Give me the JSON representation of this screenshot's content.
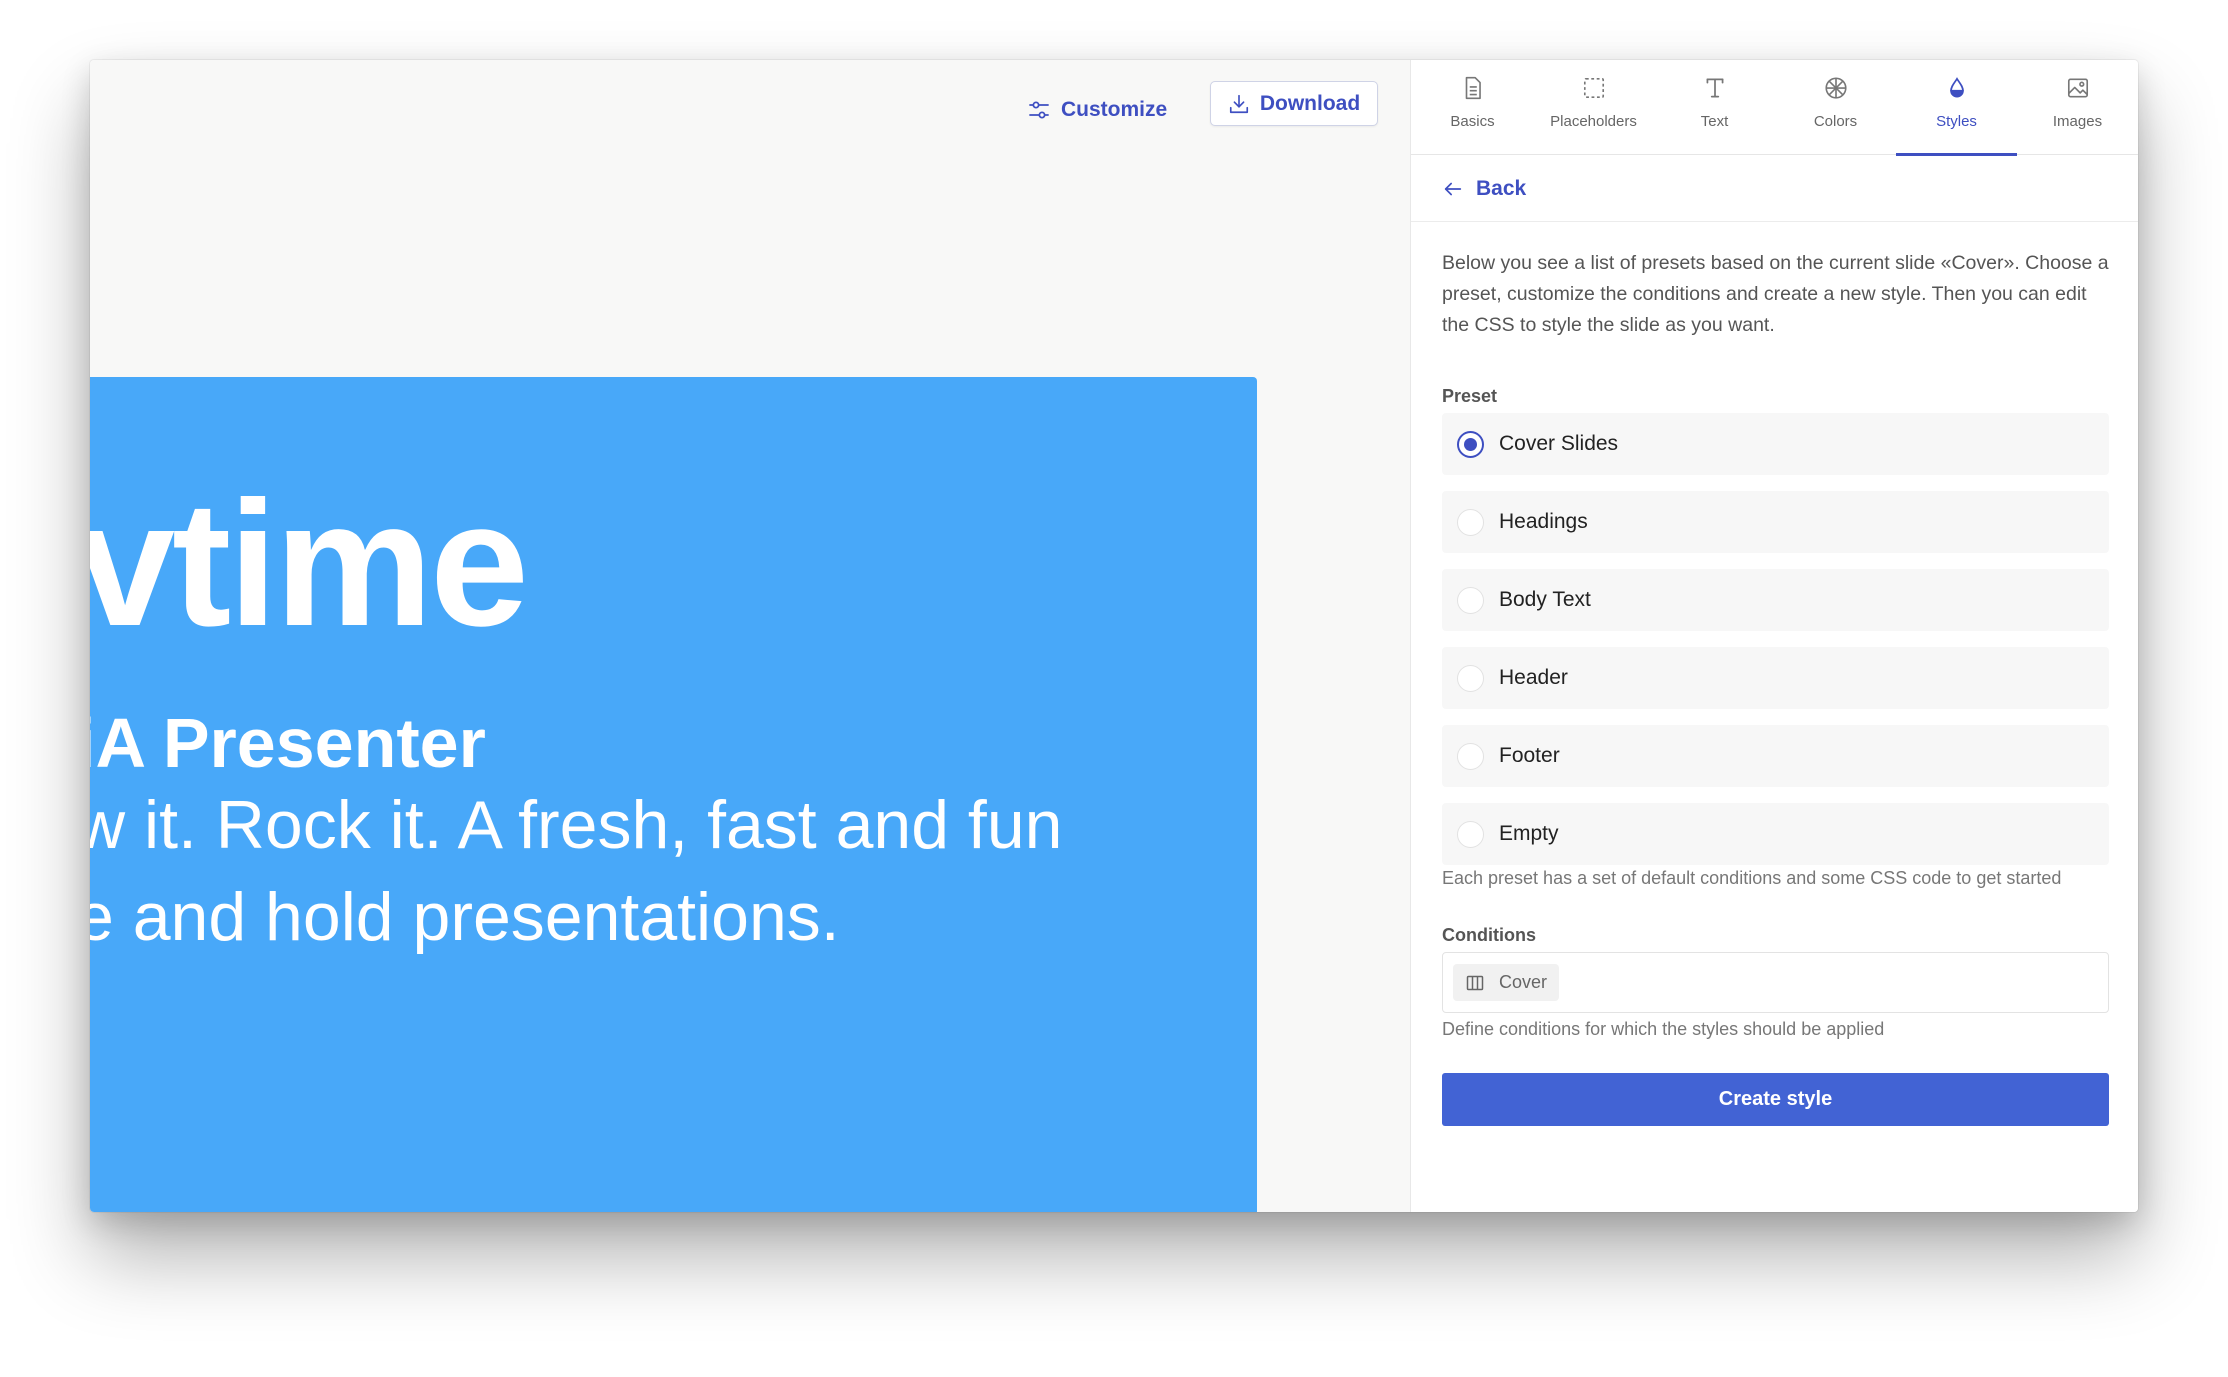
{
  "toolbar": {
    "customize_label": "Customize",
    "download_label": "Download"
  },
  "slide": {
    "title": "vtime",
    "subtitle": "iA Presenter",
    "body_line_1": "w it. Rock it. A fresh, fast and fun",
    "body_line_2": "e and hold presentations.",
    "background_color": "#48a8f9"
  },
  "tabs": [
    {
      "label": "Basics",
      "icon": "document-icon",
      "active": false
    },
    {
      "label": "Placeholders",
      "icon": "dashed-square-icon",
      "active": false
    },
    {
      "label": "Text",
      "icon": "text-t-icon",
      "active": false
    },
    {
      "label": "Colors",
      "icon": "color-wheel-icon",
      "active": false
    },
    {
      "label": "Styles",
      "icon": "drop-icon",
      "active": true
    },
    {
      "label": "Images",
      "icon": "image-icon",
      "active": false
    }
  ],
  "back_label": "Back",
  "intro_text": "Below you see a list of presets based on the current slide «Cover». Choose a preset, customize the conditions and create a new style. Then you can edit the CSS to style the slide as you want.",
  "preset_section": {
    "label": "Preset",
    "options": [
      {
        "label": "Cover Slides",
        "selected": true
      },
      {
        "label": "Headings",
        "selected": false
      },
      {
        "label": "Body Text",
        "selected": false
      },
      {
        "label": "Header",
        "selected": false
      },
      {
        "label": "Footer",
        "selected": false
      },
      {
        "label": "Empty",
        "selected": false
      }
    ],
    "help": "Each preset has a set of default conditions and some CSS code to get started"
  },
  "conditions_section": {
    "label": "Conditions",
    "chip_label": "Cover",
    "help": "Define conditions for which the styles should be applied"
  },
  "create_button_label": "Create style",
  "colors": {
    "accent": "#3e4fc1",
    "primary_button": "#4263d4",
    "slide_blue": "#48a8f9"
  }
}
